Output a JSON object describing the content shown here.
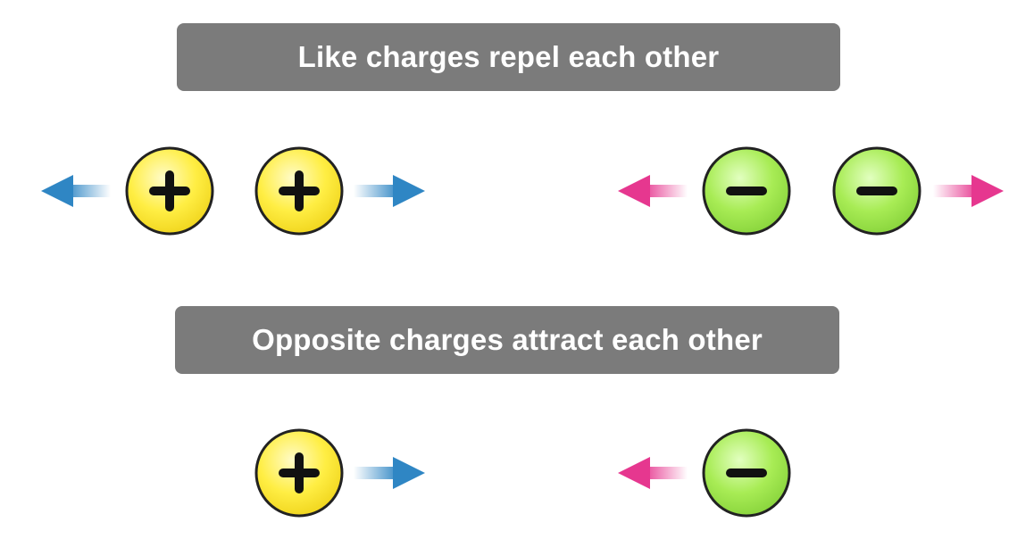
{
  "banners": {
    "repel": "Like charges repel each other",
    "attract": "Opposite charges attract each other"
  },
  "colors": {
    "banner_bg": "#7b7b7b",
    "banner_text": "#ffffff",
    "positive_fill": "#ffee44",
    "negative_fill": "#a8ec55",
    "charge_outline": "#222222",
    "positive_arrow": "#2f86c4",
    "negative_arrow": "#e6378f"
  },
  "charges": [
    {
      "id": "like-pos-left",
      "sign": "+"
    },
    {
      "id": "like-pos-right",
      "sign": "+"
    },
    {
      "id": "like-neg-left",
      "sign": "-"
    },
    {
      "id": "like-neg-right",
      "sign": "-"
    },
    {
      "id": "opp-pos",
      "sign": "+"
    },
    {
      "id": "opp-neg",
      "sign": "-"
    }
  ],
  "arrows": [
    {
      "id": "like-pos-arrow-left",
      "direction": "left",
      "color": "blue"
    },
    {
      "id": "like-pos-arrow-right",
      "direction": "right",
      "color": "blue"
    },
    {
      "id": "like-neg-arrow-left",
      "direction": "left",
      "color": "pink"
    },
    {
      "id": "like-neg-arrow-right",
      "direction": "right",
      "color": "pink"
    },
    {
      "id": "opp-pos-arrow",
      "direction": "right",
      "color": "blue"
    },
    {
      "id": "opp-neg-arrow",
      "direction": "left",
      "color": "pink"
    }
  ]
}
